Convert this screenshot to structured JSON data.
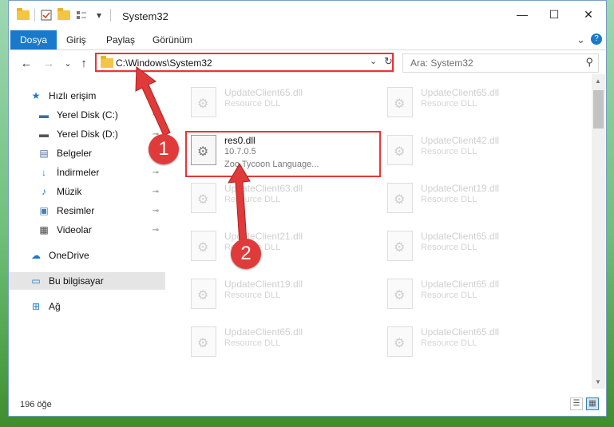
{
  "window": {
    "title": "System32",
    "controls": {
      "minimize": "—",
      "maximize": "☐",
      "close": "✕"
    }
  },
  "quick_access_toolbar": {
    "dropdown": "▾"
  },
  "ribbon": {
    "tabs": [
      {
        "label": "Dosya",
        "active": true
      },
      {
        "label": "Giriş",
        "active": false
      },
      {
        "label": "Paylaş",
        "active": false
      },
      {
        "label": "Görünüm",
        "active": false
      }
    ],
    "expand_glyph": "⌄",
    "help_glyph": "?"
  },
  "navigation": {
    "back_glyph": "←",
    "forward_glyph": "→",
    "recent_glyph": "⌄",
    "up_glyph": "↑",
    "address": "C:\\Windows\\System32",
    "address_dropdown_glyph": "⌄",
    "refresh_glyph": "↻",
    "search_placeholder": "Ara: System32",
    "search_glyph": "⚲"
  },
  "sidebar": {
    "items": [
      {
        "label": "Hızlı erişim",
        "icon": "star-icon",
        "glyph": "★",
        "color": "#1979ca",
        "pinned": false
      },
      {
        "label": "Yerel Disk (C:)",
        "icon": "drive-icon",
        "glyph": "▬",
        "color": "#3b6ea5",
        "pinned": true
      },
      {
        "label": "Yerel Disk (D:)",
        "icon": "drive-icon",
        "glyph": "▬",
        "color": "#555555",
        "pinned": true
      },
      {
        "label": "Belgeler",
        "icon": "documents-icon",
        "glyph": "▤",
        "color": "#4a6fa5",
        "pinned": true
      },
      {
        "label": "İndirmeler",
        "icon": "download-icon",
        "glyph": "↓",
        "color": "#1979ca",
        "pinned": true
      },
      {
        "label": "Müzik",
        "icon": "music-icon",
        "glyph": "♪",
        "color": "#1979ca",
        "pinned": true
      },
      {
        "label": "Resimler",
        "icon": "pictures-icon",
        "glyph": "▣",
        "color": "#4a7fb0",
        "pinned": true
      },
      {
        "label": "Videolar",
        "icon": "video-icon",
        "glyph": "▦",
        "color": "#444444",
        "pinned": true
      },
      {
        "label": "OneDrive",
        "icon": "cloud-icon",
        "glyph": "☁",
        "color": "#1979ca",
        "pinned": false
      },
      {
        "label": "Bu bilgisayar",
        "icon": "computer-icon",
        "glyph": "▭",
        "color": "#1979ca",
        "pinned": false,
        "selected": true
      },
      {
        "label": "Ağ",
        "icon": "network-icon",
        "glyph": "⊞",
        "color": "#1979ca",
        "pinned": false
      }
    ],
    "pin_glyph": "📌"
  },
  "files": {
    "main": {
      "name": "res0.dll",
      "version": "10.7.0.5",
      "description": "Zoo Tycoon Language..."
    },
    "left_column": [
      {
        "name": "UpdateClient65.dll",
        "type": "Resource DLL"
      },
      {
        "name": "UpdateClient63.dll",
        "type": "Resource DLL"
      },
      {
        "name": "UpdateClient21.dll",
        "type": "Resource DLL"
      },
      {
        "name": "UpdateClient19.dll",
        "type": "Resource DLL"
      },
      {
        "name": "UpdateClient65.dll",
        "type": "Resource DLL"
      }
    ],
    "right_column": [
      {
        "name": "UpdateClient65.dll",
        "type": "Resource DLL"
      },
      {
        "name": "UpdateClient42.dll",
        "type": "Resource DLL"
      },
      {
        "name": "UpdateClient19.dll",
        "type": "Resource DLL"
      },
      {
        "name": "UpdateClient65.dll",
        "type": "Resource DLL"
      },
      {
        "name": "UpdateClient65.dll",
        "type": "Resource DLL"
      },
      {
        "name": "UpdateClient65.dll",
        "type": "Resource DLL"
      }
    ]
  },
  "status": {
    "item_count": "196 öğe"
  },
  "view_buttons": {
    "details": "☰",
    "tiles": "▦"
  },
  "callouts": {
    "step1": "1",
    "step2": "2",
    "color": "#e03a3a"
  }
}
